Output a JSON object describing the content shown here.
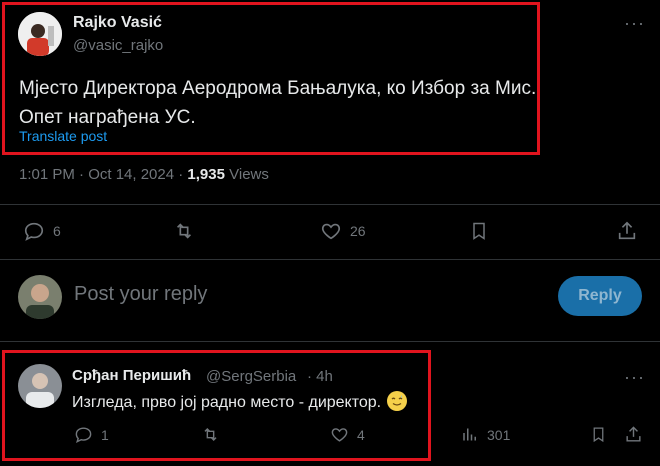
{
  "post": {
    "author_name": "Rajko Vasić",
    "author_handle": "@vasic_rajko",
    "text_line1": "Мјесто Директора Аеродрома Бањалука, ко Избор за Мис.",
    "text_line2": "Опет награђена УС.",
    "translate": "Translate post",
    "time": "1:01 PM · Oct 14, 2024 · ",
    "views_count": "1,935",
    "views_label": " Views",
    "replies": "6",
    "likes": "26"
  },
  "composer": {
    "placeholder": "Post your reply",
    "reply_button": "Reply"
  },
  "reply": {
    "author_name": "Срђан Перишић",
    "author_handle": "@SergSerbia",
    "time": "· 4h",
    "text": "Изгледа, прво јој радно место - директор.",
    "replies": "1",
    "likes": "4",
    "views": "301"
  },
  "colors": {
    "highlight": "#e0141e",
    "link": "#1d9bf0",
    "muted": "#71767b",
    "reply_button": "#1a6fa8"
  }
}
